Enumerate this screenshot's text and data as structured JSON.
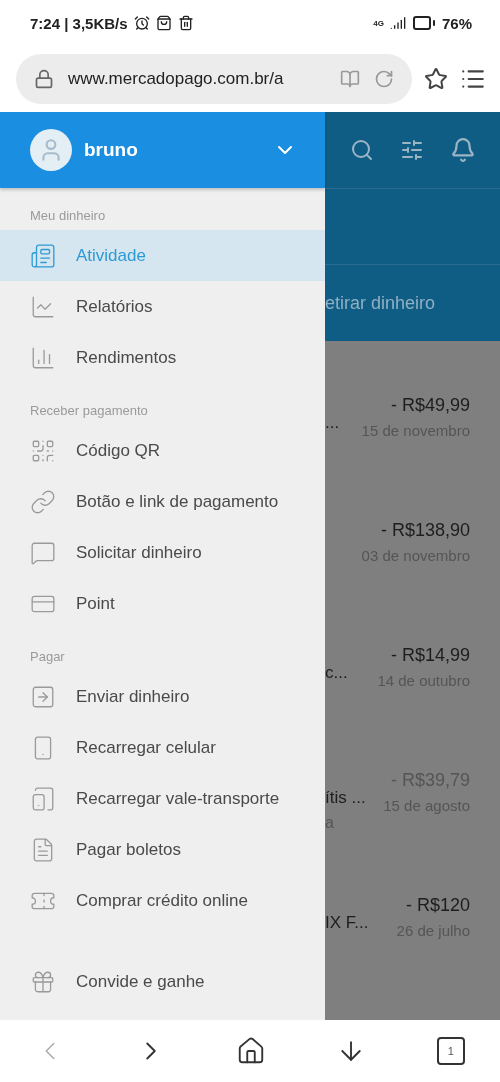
{
  "status_bar": {
    "time_speed": "7:24 | 3,5KB/s",
    "network": "4G",
    "battery": "76%"
  },
  "address_bar": {
    "url": "www.mercadopago.com.br/a"
  },
  "background_page": {
    "action_label": "etirar dinheiro",
    "rows": [
      {
        "fragment": "...",
        "amount": "- R$49,99",
        "date": "15 de novembro",
        "faded": false
      },
      {
        "fragment": "",
        "amount": "- R$138,90",
        "date": "03 de novembro",
        "faded": false
      },
      {
        "fragment": "c...",
        "amount": "- R$14,99",
        "date": "14 de outubro",
        "faded": false
      },
      {
        "fragment": "ítis ...",
        "fragment_2": "a",
        "amount": "- R$39,79",
        "date": "15 de agosto",
        "faded": true
      },
      {
        "fragment": "IX F...",
        "amount": "- R$120",
        "date": "26 de julho",
        "faded": false
      }
    ]
  },
  "drawer": {
    "user": {
      "name": "bruno"
    },
    "sections": [
      {
        "title": "Meu dinheiro",
        "items": [
          {
            "label": "Atividade",
            "selected": true
          },
          {
            "label": "Relatórios",
            "selected": false
          },
          {
            "label": "Rendimentos",
            "selected": false
          }
        ]
      },
      {
        "title": "Receber pagamento",
        "items": [
          {
            "label": "Código QR",
            "selected": false
          },
          {
            "label": "Botão e link de pagamento",
            "selected": false
          },
          {
            "label": "Solicitar dinheiro",
            "selected": false
          },
          {
            "label": "Point",
            "selected": false
          }
        ]
      },
      {
        "title": "Pagar",
        "items": [
          {
            "label": "Enviar dinheiro",
            "selected": false
          },
          {
            "label": "Recarregar celular",
            "selected": false
          },
          {
            "label": "Recarregar vale-transporte",
            "selected": false
          },
          {
            "label": "Pagar boletos",
            "selected": false
          },
          {
            "label": "Comprar crédito online",
            "selected": false
          }
        ]
      },
      {
        "items": [
          {
            "label": "Convide e ganhe",
            "selected": false
          }
        ]
      }
    ]
  },
  "bottom_nav": {
    "tab_count": "1"
  }
}
